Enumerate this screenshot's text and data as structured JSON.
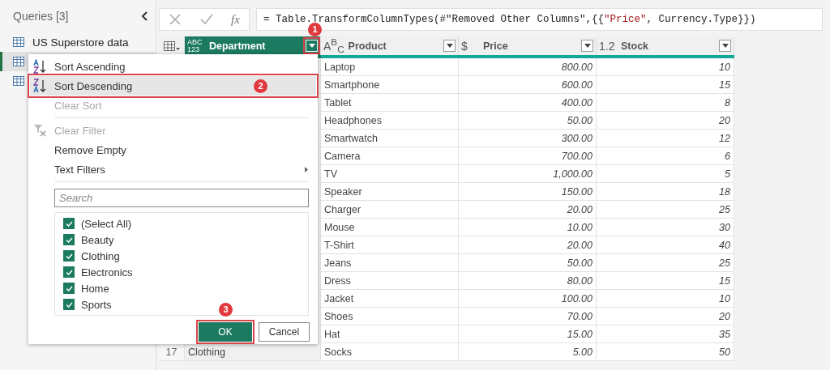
{
  "queries_pane": {
    "title": "Queries [3]",
    "items": [
      {
        "name": "US Superstore data",
        "selected": false
      },
      {
        "selected": true
      },
      {
        "selected": false
      }
    ]
  },
  "formula_bar": {
    "fx": "fx",
    "formula": [
      {
        "kind": "code",
        "text": "= Table.TransformColumnTypes(#\"Removed Other Columns\",{{"
      },
      {
        "kind": "string",
        "text": "\"Price\""
      },
      {
        "kind": "code",
        "text": ", Currency.Type}})"
      }
    ]
  },
  "table": {
    "columns": [
      {
        "type": [
          "ABC",
          "123"
        ],
        "name": "Department",
        "selected": true
      },
      {
        "type": [
          "A$^{B}$$_{C}$"
        ],
        "name": "Product",
        "selected": false
      },
      {
        "type": [
          "$"
        ],
        "name": "Price",
        "selected": false
      },
      {
        "type": [
          "1.2"
        ],
        "name": "Stock",
        "selected": false
      }
    ],
    "rows": [
      {
        "cells": [
          null,
          "Laptop",
          "800.00",
          "10"
        ]
      },
      {
        "cells": [
          null,
          "Smartphone",
          "600.00",
          "15"
        ]
      },
      {
        "cells": [
          null,
          "Tablet",
          "400.00",
          "8"
        ]
      },
      {
        "cells": [
          null,
          "Headphones",
          "50.00",
          "20"
        ]
      },
      {
        "cells": [
          null,
          "Smartwatch",
          "300.00",
          "12"
        ]
      },
      {
        "cells": [
          null,
          "Camera",
          "700.00",
          "6"
        ]
      },
      {
        "cells": [
          null,
          "TV",
          "1,000.00",
          "5"
        ]
      },
      {
        "cells": [
          null,
          "Speaker",
          "150.00",
          "18"
        ]
      },
      {
        "cells": [
          null,
          "Charger",
          "20.00",
          "25"
        ]
      },
      {
        "cells": [
          null,
          "Mouse",
          "10.00",
          "30"
        ]
      },
      {
        "cells": [
          null,
          "T-Shirt",
          "20.00",
          "40"
        ]
      },
      {
        "cells": [
          null,
          "Jeans",
          "50.00",
          "25"
        ]
      },
      {
        "cells": [
          null,
          "Dress",
          "80.00",
          "15"
        ]
      },
      {
        "cells": [
          null,
          "Jacket",
          "100.00",
          "10"
        ]
      },
      {
        "cells": [
          null,
          "Shoes",
          "70.00",
          "20"
        ]
      },
      {
        "cells": [
          null,
          "Hat",
          "15.00",
          "35"
        ]
      },
      {
        "number": "17",
        "cells": [
          "Clothing",
          "Socks",
          "5.00",
          "50"
        ]
      }
    ]
  },
  "filter_menu": {
    "items": [
      {
        "kind": "sort-ascending",
        "label": "Sort Ascending",
        "disabled": false,
        "selected": false
      },
      {
        "kind": "sort-descending",
        "label": "Sort Descending",
        "disabled": false,
        "selected": true
      },
      {
        "kind": "plain",
        "label": "Clear Sort",
        "disabled": true,
        "selected": false
      },
      {
        "kind": "separator"
      },
      {
        "kind": "clear-filter",
        "label": "Clear Filter",
        "disabled": true,
        "selected": false
      },
      {
        "kind": "plain",
        "label": "Remove Empty",
        "disabled": false,
        "selected": false
      },
      {
        "kind": "submenu",
        "label": "Text Filters",
        "disabled": false,
        "selected": false
      },
      {
        "kind": "separator"
      }
    ],
    "search": {
      "placeholder": "Search"
    },
    "values": [
      {
        "label": "(Select All)",
        "checked": true
      },
      {
        "label": "Beauty",
        "checked": true
      },
      {
        "label": "Clothing",
        "checked": true
      },
      {
        "label": "Electronics",
        "checked": true
      },
      {
        "label": "Home",
        "checked": true
      },
      {
        "label": "Sports",
        "checked": true
      }
    ],
    "buttons": [
      {
        "kind": "primary",
        "label": "OK"
      },
      {
        "kind": "secondary",
        "label": "Cancel"
      }
    ]
  },
  "annotations": [
    {
      "number": "1"
    },
    {
      "number": "2"
    },
    {
      "number": "3"
    }
  ]
}
